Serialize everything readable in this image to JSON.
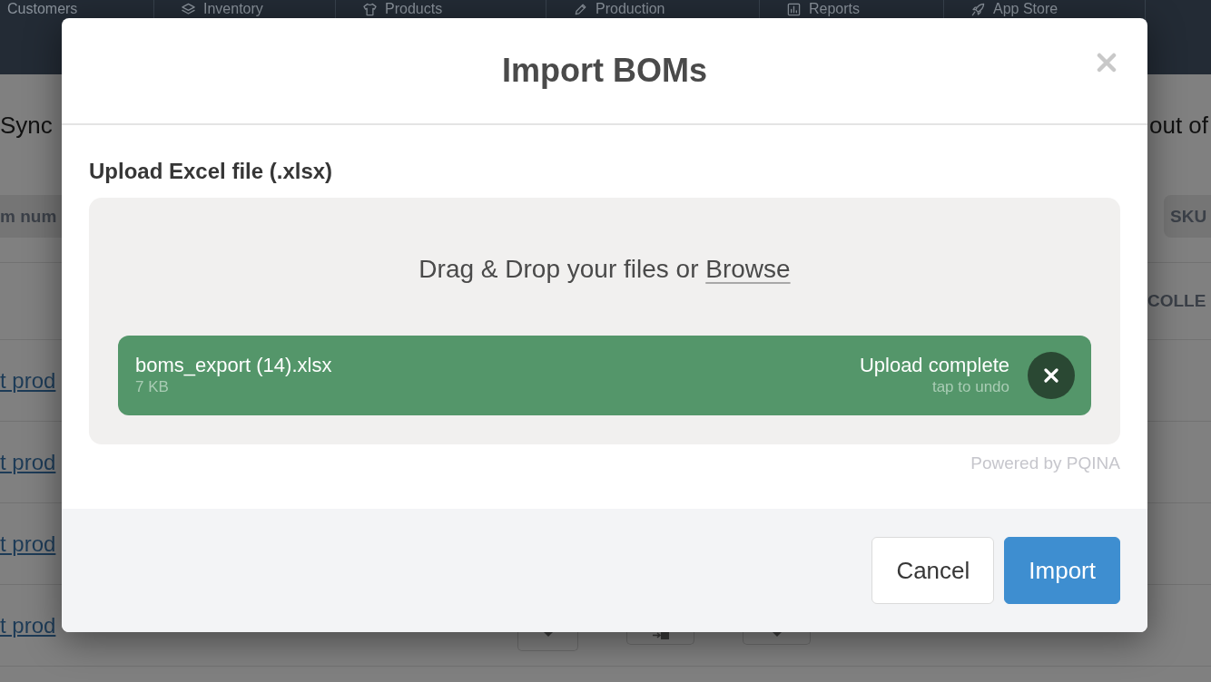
{
  "nav": {
    "items": [
      {
        "label": "Customers"
      },
      {
        "label": "Inventory"
      },
      {
        "label": "Products"
      },
      {
        "label": "Production"
      },
      {
        "label": "Reports"
      },
      {
        "label": "App Store"
      }
    ]
  },
  "page": {
    "title_left": "Sync",
    "title_right": "out of",
    "table": {
      "columns": [
        "m num",
        "SKU"
      ],
      "rows": [
        {
          "right_cell": "COLLE"
        },
        {
          "link": "t prod"
        },
        {
          "link": "t prod"
        },
        {
          "link": "t prod"
        },
        {
          "link": "t prod"
        }
      ]
    }
  },
  "modal": {
    "title": "Import BOMs",
    "field_label": "Upload Excel file (.xlsx)",
    "dropzone": {
      "prompt": "Drag & Drop your files or",
      "browse_link": "Browse",
      "files": [
        {
          "name": "boms_export (14).xlsx",
          "size": "7 KB",
          "status": "Upload complete",
          "hint": "tap to undo"
        }
      ]
    },
    "credit": "Powered by PQINA",
    "buttons": [
      {
        "label": "Cancel",
        "kind": "secondary"
      },
      {
        "label": "Import",
        "kind": "primary"
      }
    ]
  }
}
